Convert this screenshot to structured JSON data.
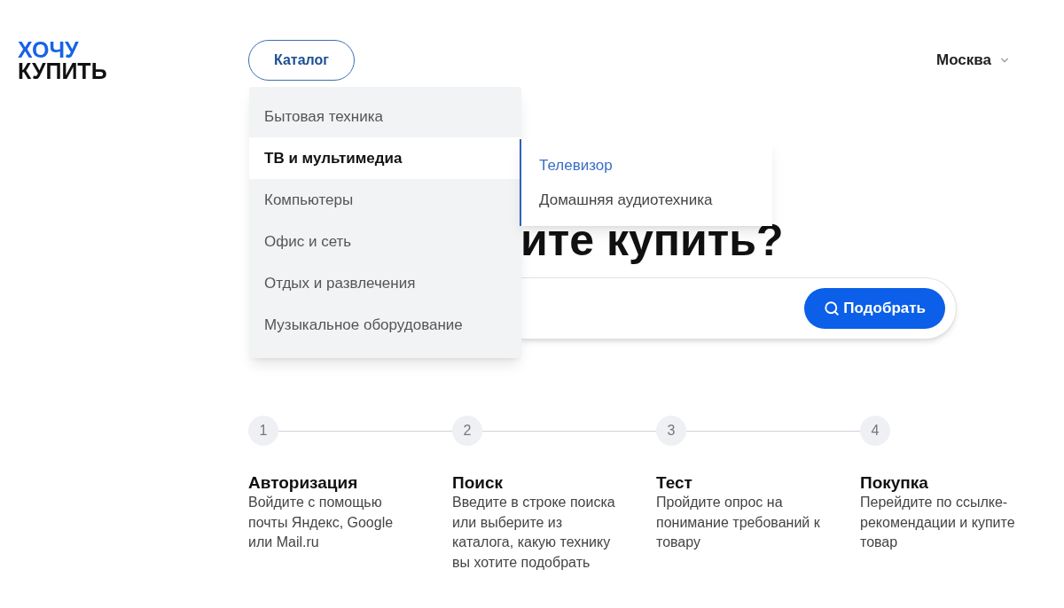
{
  "logo": {
    "line_1": "ХОЧУ",
    "line_2": "КУПИТЬ"
  },
  "catalog_button": "Каталог",
  "city": "Москва",
  "menu": {
    "items": [
      {
        "label": "Бытовая техника",
        "selected": false
      },
      {
        "label": "ТВ и мультимедиа",
        "selected": true
      },
      {
        "label": "Компьютеры",
        "selected": false
      },
      {
        "label": "Офис и сеть",
        "selected": false
      },
      {
        "label": "Отдых и развлечения",
        "selected": false
      },
      {
        "label": "Музыкальное оборудование",
        "selected": false
      }
    ],
    "submenu": [
      {
        "label": "Телевизор",
        "selected": true
      },
      {
        "label": "Домашняя аудиотехника",
        "selected": false
      }
    ]
  },
  "heading": "ите купить?",
  "search_button": "Подобрать",
  "steps": [
    {
      "number": "1",
      "title": "Авторизация",
      "text": "Войдите с помощью почты Яндекс, Google или Mail.ru"
    },
    {
      "number": "2",
      "title": "Поиск",
      "text": "Введите в строке поиска или выберите из каталога, какую технику вы хотите подобрать"
    },
    {
      "number": "3",
      "title": "Тест",
      "text": "Пройдите опрос на понимание требований к товару"
    },
    {
      "number": "4",
      "title": "Покупка",
      "text": "Перейдите по ссылке-рекомендации и купите товар"
    }
  ]
}
